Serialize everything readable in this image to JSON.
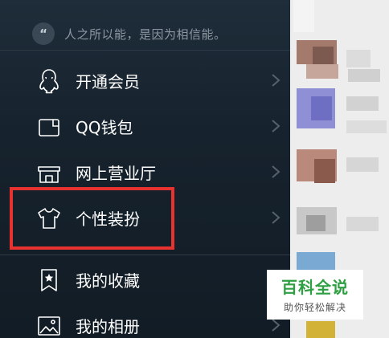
{
  "signature": {
    "icon": "quote-icon",
    "glyph": "“",
    "text": "人之所以能，是因为相信能。"
  },
  "menu": {
    "items": [
      {
        "label": "开通会员",
        "icon": "penguin-icon"
      },
      {
        "label": "QQ钱包",
        "icon": "wallet-icon"
      },
      {
        "label": "网上营业厅",
        "icon": "storefront-icon"
      },
      {
        "label": "个性装扮",
        "icon": "tshirt-icon"
      },
      {
        "label": "我的收藏",
        "icon": "bookmark-star-icon"
      },
      {
        "label": "我的相册",
        "icon": "photo-icon"
      }
    ]
  },
  "highlight": {
    "target": "个性装扮",
    "color": "#e8322f"
  },
  "watermark": {
    "title": "百科全说",
    "subtitle": "助你轻松解决"
  },
  "colors": {
    "drawer_bg": "#16222d",
    "text": "#ffffff",
    "muted": "#8c97a2",
    "brand": "#2ea043"
  }
}
